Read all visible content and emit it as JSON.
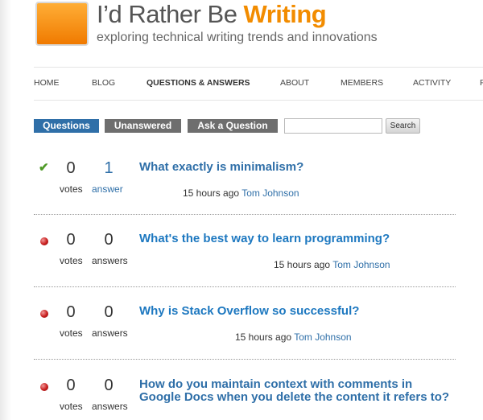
{
  "header": {
    "title_main": "I’d Rather Be ",
    "title_accent": "Writing",
    "tagline": "exploring technical writing trends and innovations"
  },
  "nav": {
    "items": [
      "HOME",
      "BLOG",
      "QUESTIONS & ANSWERS",
      "ABOUT",
      "MEMBERS",
      "ACTIVITY",
      "F"
    ],
    "active": "QUESTIONS & ANSWERS"
  },
  "subtabs": {
    "questions": "Questions",
    "unanswered": "Unanswered",
    "ask": "Ask a Question",
    "search_value": "",
    "search_button": "Search"
  },
  "questions": [
    {
      "status": "answered",
      "votes": "0",
      "votes_label": "votes",
      "answers": "1",
      "answers_label": "answer",
      "title": "What exactly is minimalism?",
      "time": "15 hours ago",
      "author": "Tom Johnson"
    },
    {
      "status": "unanswered",
      "votes": "0",
      "votes_label": "votes",
      "answers": "0",
      "answers_label": "answers",
      "title": "What's the best way to learn programming?",
      "time": "15 hours ago",
      "author": "Tom Johnson"
    },
    {
      "status": "unanswered",
      "votes": "0",
      "votes_label": "votes",
      "answers": "0",
      "answers_label": "answers",
      "title": "Why is Stack Overflow so successful?",
      "time": "15 hours ago",
      "author": "Tom Johnson"
    },
    {
      "status": "unanswered",
      "votes": "0",
      "votes_label": "votes",
      "answers": "0",
      "answers_label": "answers",
      "title": "How do you maintain context with comments in Google Docs when you delete the content it refers to?",
      "time": "",
      "author": ""
    }
  ],
  "colors": {
    "accent_orange": "#f28c00",
    "link_blue": "#2f6fa8",
    "answered_check": "#4f9a27",
    "unanswered_dot": "#c81d1d"
  }
}
